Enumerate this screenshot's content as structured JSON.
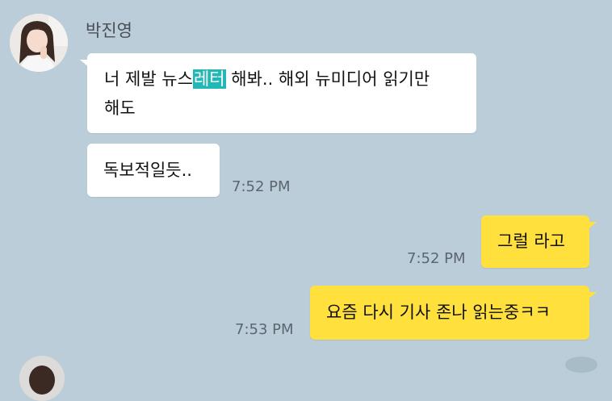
{
  "chat": {
    "sender": "박진영",
    "messages": [
      {
        "side": "left",
        "text_before": "너 제발 뉴스",
        "highlight": "레터",
        "text_after": " 해봐.. 해외 뉴미디어 읽기만",
        "line2": "해도"
      },
      {
        "side": "left",
        "text": "독보적일듯..",
        "time": "7:52 PM"
      },
      {
        "side": "right",
        "text": "그럴 라고",
        "time": "7:52 PM"
      },
      {
        "side": "right",
        "text": "요즘 다시 기사 존나 읽는중ㅋㅋ",
        "time": "7:53 PM"
      }
    ]
  },
  "colors": {
    "background": "#bacdd9",
    "incoming_bubble": "#ffffff",
    "outgoing_bubble": "#ffe03d",
    "highlight": "#23b7b5"
  }
}
